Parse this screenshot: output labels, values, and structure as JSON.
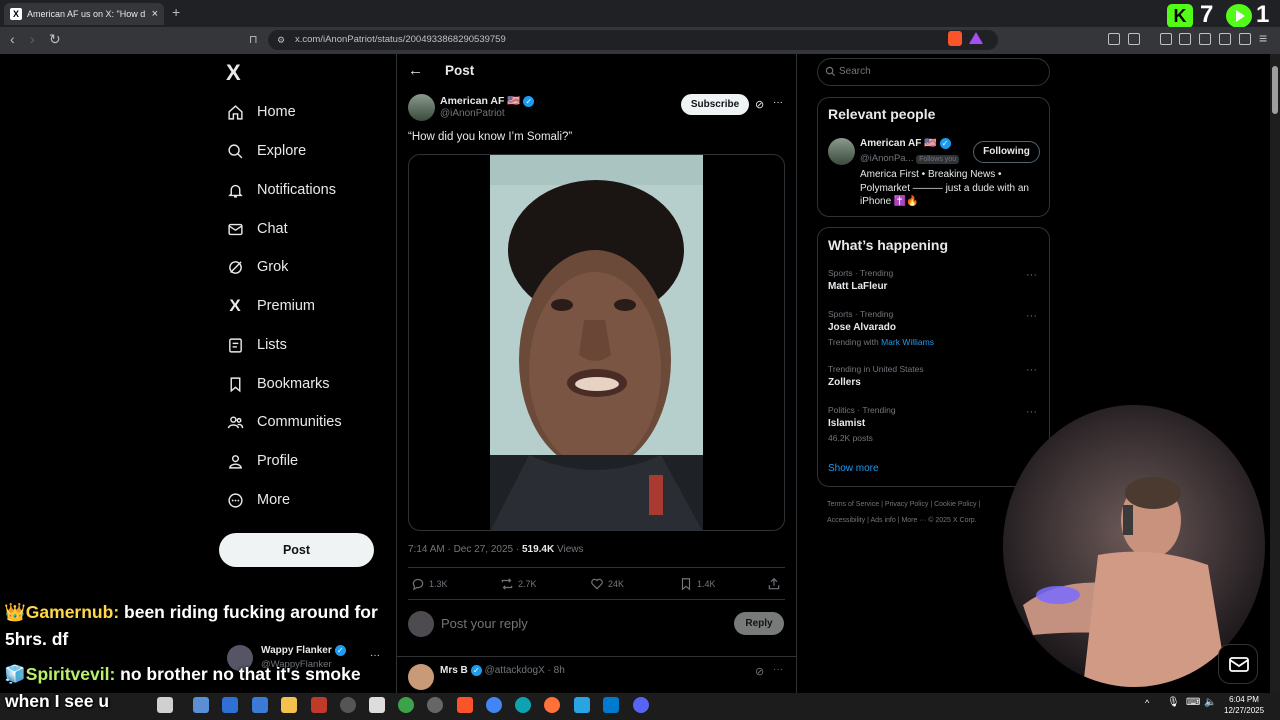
{
  "browser": {
    "tab_title": "American AF us on X: \"How d",
    "tab_favicon": "X",
    "close_tab": "×",
    "new_tab": "+",
    "url": "x.com/iAnonPatriot/status/2004933868290539759"
  },
  "stream_overlay": {
    "kick_logo": "K",
    "kick_count": "7",
    "rumble_count": "1"
  },
  "sidebar": {
    "logo": "X",
    "items": [
      {
        "label": "Home",
        "icon": "home-icon"
      },
      {
        "label": "Explore",
        "icon": "search-icon"
      },
      {
        "label": "Notifications",
        "icon": "bell-icon"
      },
      {
        "label": "Chat",
        "icon": "mail-icon"
      },
      {
        "label": "Grok",
        "icon": "grok-icon"
      },
      {
        "label": "Premium",
        "icon": "x-icon"
      },
      {
        "label": "Lists",
        "icon": "list-icon"
      },
      {
        "label": "Bookmarks",
        "icon": "bookmark-icon"
      },
      {
        "label": "Communities",
        "icon": "people-icon"
      },
      {
        "label": "Profile",
        "icon": "person-icon"
      },
      {
        "label": "More",
        "icon": "more-icon"
      }
    ],
    "post_button": "Post",
    "account_name": "Wappy Flanker",
    "account_handle": "@WappyFlanker"
  },
  "post": {
    "header_title": "Post",
    "author_name": "American AF 🇺🇸",
    "author_handle": "@iAnonPatriot",
    "subscribe_label": "Subscribe",
    "text": "“How did you know I’m Somali?”",
    "timestamp": "7:14 AM · Dec 27, 2025 · ",
    "views_count": "519.4K",
    "views_label": " Views",
    "replies": "1.3K",
    "reposts": "2.7K",
    "likes": "24K",
    "bookmarks": "1.4K",
    "reply_placeholder": "Post your reply",
    "reply_button": "Reply",
    "next_reply_name": "Mrs B",
    "next_reply_handle": "@attackdogX · 8h"
  },
  "right": {
    "search_placeholder": "Search",
    "relevant_title": "Relevant people",
    "person_name": "American AF 🇺🇸",
    "person_handle": "@iAnonPa...",
    "follows_you": "Follows you",
    "following_label": "Following",
    "bio": "America First • Breaking News • Polymarket ——— just a dude with an iPhone ✝️🔥",
    "happening_title": "What’s happening",
    "trends": [
      {
        "meta": "Sports · Trending",
        "name": "Matt LaFleur"
      },
      {
        "meta": "Sports · Trending",
        "name": "Jose Alvarado",
        "extra_prefix": "Trending with ",
        "extra_link": "Mark Williams"
      },
      {
        "meta": "Trending in United States",
        "name": "Zollers"
      },
      {
        "meta": "Politics · Trending",
        "name": "Islamist",
        "count": "46.2K posts"
      }
    ],
    "show_more": "Show more",
    "footer_line1": "Terms of Service  |  Privacy Policy  |  Cookie Policy  |",
    "footer_line2": "Accessibility  |  Ads info  |  More ···  © 2025 X Corp."
  },
  "chat": [
    {
      "user": "Gamernub:",
      "message": "been riding fucking around for",
      "message2": "5hrs. df"
    },
    {
      "user": "Spiritvevil:",
      "message": "no brother no that it's smoke",
      "message2": "when I see u"
    }
  ],
  "taskbar": {
    "time": "6:04 PM",
    "date": "12/27/2025"
  }
}
